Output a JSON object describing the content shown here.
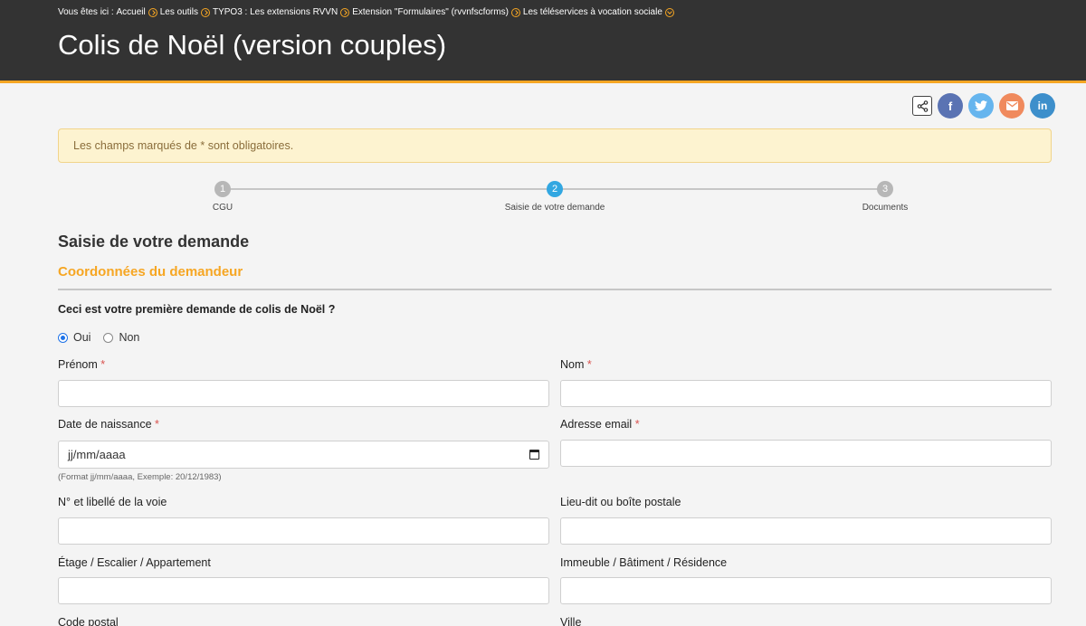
{
  "breadcrumb": {
    "prefix": "Vous êtes ici :",
    "items": [
      "Accueil",
      "Les outils",
      "TYPO3 : Les extensions RVVN",
      "Extension \"Formulaires\" (rvvnfscforms)",
      "Les téléservices à vocation sociale"
    ]
  },
  "page": {
    "title": "Colis de Noël (version couples)"
  },
  "share": {
    "icons": [
      "share-icon",
      "facebook-icon",
      "twitter-icon",
      "mail-icon",
      "linkedin-icon"
    ],
    "linkedin_text": "in",
    "facebook_text": "f"
  },
  "notice": {
    "text": "Les champs marqués de * sont obligatoires."
  },
  "stepper": {
    "steps": [
      {
        "number": "1",
        "label": "CGU"
      },
      {
        "number": "2",
        "label": "Saisie de votre demande"
      },
      {
        "number": "3",
        "label": "Documents"
      }
    ],
    "active_step": "2"
  },
  "form": {
    "section_title": "Saisie de votre demande",
    "subsection_title": "Coordonnées du demandeur",
    "question": "Ceci est votre première demande de colis de Noël ?",
    "options": [
      {
        "label": "Oui",
        "checked": true
      },
      {
        "label": "Non",
        "checked": false
      }
    ],
    "fields": {
      "prenom": {
        "label": "Prénom",
        "required": "*",
        "value": ""
      },
      "nom": {
        "label": "Nom",
        "required": "*",
        "value": ""
      },
      "date_naissance": {
        "label": "Date de naissance",
        "required": "*",
        "placeholder": "jj/mm/aaaa",
        "help": "(Format jj/mm/aaaa, Exemple: 20/12/1983)"
      },
      "email": {
        "label": "Adresse email",
        "required": "*",
        "value": ""
      },
      "voie": {
        "label": "N° et libellé de la voie",
        "value": ""
      },
      "lieu_dit": {
        "label": "Lieu-dit ou boîte postale",
        "value": ""
      },
      "etage": {
        "label": "Étage / Escalier / Appartement",
        "value": ""
      },
      "immeuble": {
        "label": "Immeuble / Bâtiment / Résidence",
        "value": ""
      },
      "code_postal": {
        "label": "Code postal"
      },
      "ville": {
        "label": "Ville"
      }
    }
  },
  "colors": {
    "header_bg": "#333333",
    "accent_orange": "#f6a623",
    "active_blue": "#32a7e1",
    "required_red": "#d9534f",
    "notice_bg": "#fdf3d0"
  }
}
